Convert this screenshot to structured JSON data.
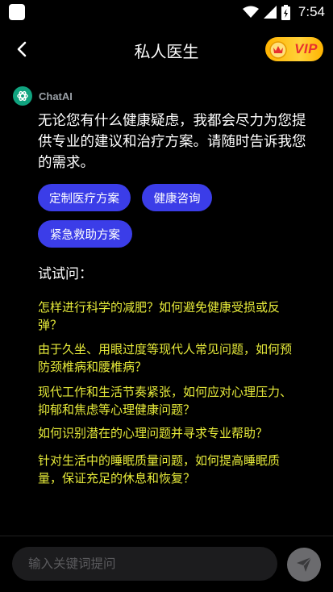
{
  "status_bar": {
    "time": "7:54",
    "icons": [
      "app-icon",
      "wifi-icon",
      "signal-icon",
      "battery-charging-icon"
    ]
  },
  "header": {
    "title": "私人医生",
    "vip_label": "VIP",
    "back_icon": "chevron-left-icon"
  },
  "chat": {
    "sender_name": "ChatAI",
    "message_lines": [
      "无论您有什么健康疑虑，我都会尽力为您提",
      "供专业的建议和治疗方案。请随时告诉我您",
      "的需求。"
    ],
    "chips": [
      "定制医疗方案",
      "健康咨询",
      "紧急救助方案"
    ],
    "try_label": "试试问：",
    "suggestions": [
      {
        "lines": [
          "怎样进行科学的减肥？如何避免健康受损或反",
          "弹？"
        ]
      },
      {
        "lines": [
          "由于久坐、用眼过度等现代人常见问题，如何预",
          "防颈椎病和腰椎病？"
        ]
      },
      {
        "lines": [
          "现代工作和生活节奏紧张，如何应对心理压力、",
          "抑郁和焦虑等心理健康问题？"
        ]
      },
      {
        "lines": [
          "如何识别潜在的心理问题并寻求专业帮助？"
        ]
      },
      {
        "lines": [
          "针对生活中的睡眠质量问题，如何提高睡眠质",
          "量，保证充足的休息和恢复？"
        ]
      }
    ]
  },
  "input": {
    "placeholder": "输入关键词提问"
  },
  "colors": {
    "background": "#000000",
    "chip": "#3b3de8",
    "suggestion_text": "#e6ea3a",
    "vip_gold": "#ffc21a",
    "vip_text": "#e8302f",
    "send_button": "#6b6b6e"
  }
}
